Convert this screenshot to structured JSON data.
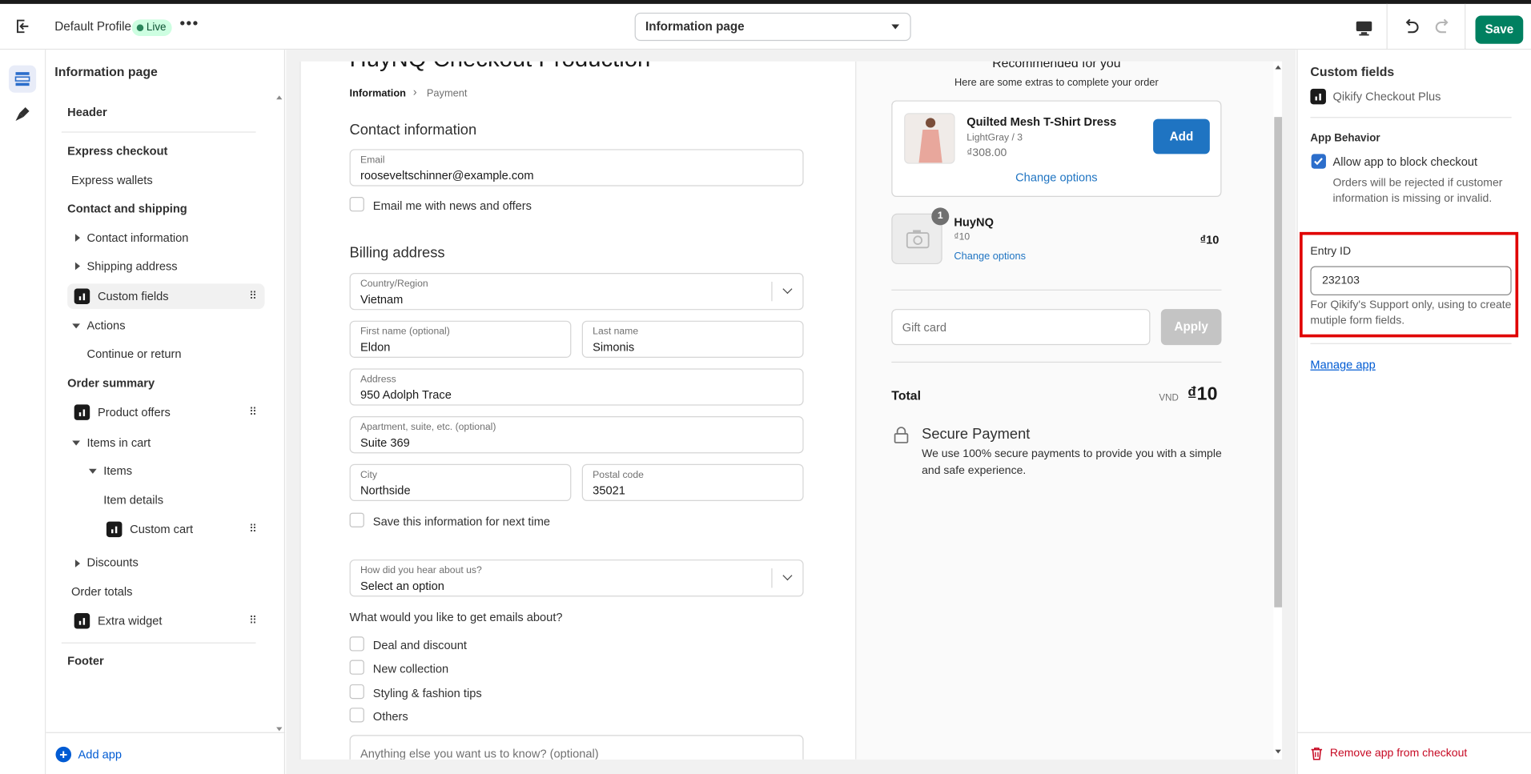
{
  "topbar": {
    "profile": "Default Profile",
    "live_badge": "Live",
    "page_select": "Information page",
    "save_label": "Save"
  },
  "left": {
    "title": "Information page",
    "items": {
      "header": "Header",
      "express_checkout": "Express checkout",
      "express_wallets": "Express wallets",
      "contact_shipping": "Contact and shipping",
      "contact_info": "Contact information",
      "shipping_address": "Shipping address",
      "custom_fields": "Custom fields",
      "actions": "Actions",
      "continue_return": "Continue or return",
      "order_summary": "Order summary",
      "product_offers": "Product offers",
      "items_in_cart": "Items in cart",
      "items": "Items",
      "item_details": "Item details",
      "custom_cart": "Custom cart",
      "discounts": "Discounts",
      "order_totals": "Order totals",
      "extra_widget": "Extra widget",
      "footer": "Footer"
    },
    "add_app": "Add app"
  },
  "preview": {
    "shop_title": "HuyNQ Checkout Production",
    "breadcrumb": [
      "Information",
      "Payment"
    ],
    "contact_heading": "Contact information",
    "email_label": "Email",
    "email_value": "rooseveltschinner@example.com",
    "email_news": "Email me with news and offers",
    "billing_heading": "Billing address",
    "country_label": "Country/Region",
    "country_value": "Vietnam",
    "first_name_label": "First name (optional)",
    "first_name_value": "Eldon",
    "last_name_label": "Last name",
    "last_name_value": "Simonis",
    "address_label": "Address",
    "address_value": "950 Adolph Trace",
    "apt_label": "Apartment, suite, etc. (optional)",
    "apt_value": "Suite 369",
    "city_label": "City",
    "city_value": "Northside",
    "postal_label": "Postal code",
    "postal_value": "35021",
    "save_info": "Save this information for next time",
    "hear_label": "How did you hear about us?",
    "hear_value": "Select an option",
    "emails_question": "What would you like to get emails about?",
    "email_topics": [
      "Deal and discount",
      "New collection",
      "Styling & fashion tips",
      "Others"
    ],
    "anything_else": "Anything else you want us to know? (optional)"
  },
  "summary": {
    "recommended_title": "Recommended for you",
    "recommended_sub": "Here are some extras to complete your order",
    "product_name": "Quilted Mesh T-Shirt Dress",
    "product_variant": "LightGray / 3",
    "product_price": "₫308.00",
    "add_label": "Add",
    "change_options": "Change options",
    "cart_item_name": "HuyNQ",
    "cart_item_price": "₫10",
    "cart_item_qty": "1",
    "cart_item_change": "Change options",
    "cart_item_total": "₫10",
    "gift_placeholder": "Gift card",
    "apply_label": "Apply",
    "total_label": "Total",
    "currency": "VND",
    "total_value": "₫10",
    "secure_title": "Secure Payment",
    "secure_text_1": "We use 100% secure payments to provide you with a simple",
    "secure_text_2": "and safe experience."
  },
  "right": {
    "title": "Custom fields",
    "app_name": "Qikify Checkout Plus",
    "behavior_heading": "App Behavior",
    "allow_block": "Allow app to block checkout",
    "allow_help_1": "Orders will be rejected if customer",
    "allow_help_2": "information is missing or invalid.",
    "entry_label": "Entry ID",
    "entry_value": "232103",
    "entry_help_1": "For Qikify's Support only, using to create",
    "entry_help_2": "mutiple form fields.",
    "manage_app": "Manage app",
    "remove_app": "Remove app from checkout",
    "highlight_color": "#e00000"
  },
  "colors": {
    "save_green": "#008060",
    "link_blue": "#005bd3",
    "add_button_blue": "#1f74c2",
    "danger_red": "#c70a24"
  }
}
